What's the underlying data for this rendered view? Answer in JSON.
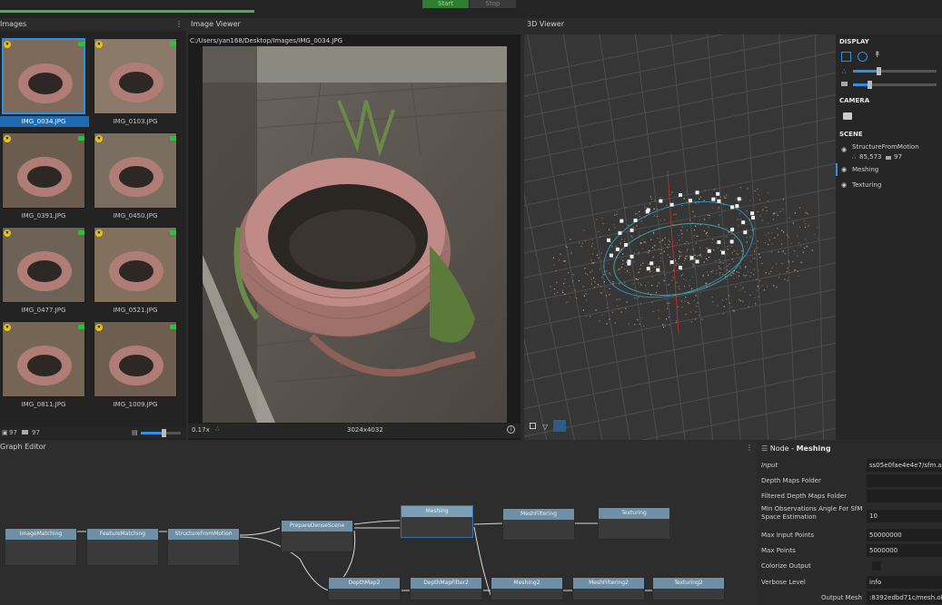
{
  "toolbar": {
    "start_label": "Start",
    "stop_label": "Stop",
    "progress_fraction": 0.27
  },
  "images_panel": {
    "title": "Images",
    "items": [
      {
        "label": "IMG_0034.JPG"
      },
      {
        "label": "IMG_0103.JPG"
      },
      {
        "label": "IMG_0391.JPG"
      },
      {
        "label": "IMG_0450.JPG"
      },
      {
        "label": "IMG_0477.JPG"
      },
      {
        "label": "IMG_0521.JPG"
      },
      {
        "label": "IMG_0811.JPG"
      },
      {
        "label": "IMG_1009.JPG"
      }
    ],
    "footer": {
      "image_count": "97",
      "camera_count": "97"
    }
  },
  "image_viewer": {
    "title": "Image Viewer",
    "path": "C:/Users/yan168/Desktop/Images/IMG_0034.JPG",
    "zoom": "0.17x",
    "resolution": "3024x4032"
  },
  "viewer3d": {
    "title": "3D Viewer",
    "display_title": "DISPLAY",
    "camera_title": "CAMERA",
    "scene_title": "SCENE",
    "scene_items": [
      {
        "label": "StructureFromMotion",
        "points": "85,573",
        "cameras": "97"
      },
      {
        "label": "Meshing"
      },
      {
        "label": "Texturing"
      }
    ]
  },
  "graph_editor": {
    "title": "Graph Editor",
    "nodes": [
      {
        "label": "ImageMatching"
      },
      {
        "label": "FeatureMatching"
      },
      {
        "label": "StructureFromMotion"
      },
      {
        "label": "PrepareDenseScene"
      },
      {
        "label": "Meshing"
      },
      {
        "label": "MeshFiltering"
      },
      {
        "label": "Texturing"
      },
      {
        "label": "DepthMap2"
      },
      {
        "label": "DepthMapFilter2"
      },
      {
        "label": "Meshing2"
      },
      {
        "label": "MeshFiltering2"
      },
      {
        "label": "Texturing2"
      }
    ]
  },
  "attribute_editor": {
    "title_prefix": "Node - ",
    "title_node": "Meshing",
    "rows": [
      {
        "label": "Input",
        "value": "ss05e0fae4e4e7/sfm.abc"
      },
      {
        "label": "Depth Maps Folder",
        "value": ""
      },
      {
        "label": "Filtered Depth Maps Folder",
        "value": ""
      },
      {
        "label": "Min Observations Angle For SfM Space Estimation",
        "value": "10"
      },
      {
        "label": "Max Input Points",
        "value": "50000000"
      },
      {
        "label": "Max Points",
        "value": "5000000"
      },
      {
        "label": "Colorize Output",
        "value": ""
      },
      {
        "label": "Verbose Level",
        "value": "info"
      },
      {
        "label": "Output Mesh",
        "value": ":8392edbd71c/mesh.obj"
      }
    ]
  },
  "colors": {
    "accent": "#2f8ee6",
    "progress": "#4caf50",
    "node_header": "#6f8fa6"
  }
}
